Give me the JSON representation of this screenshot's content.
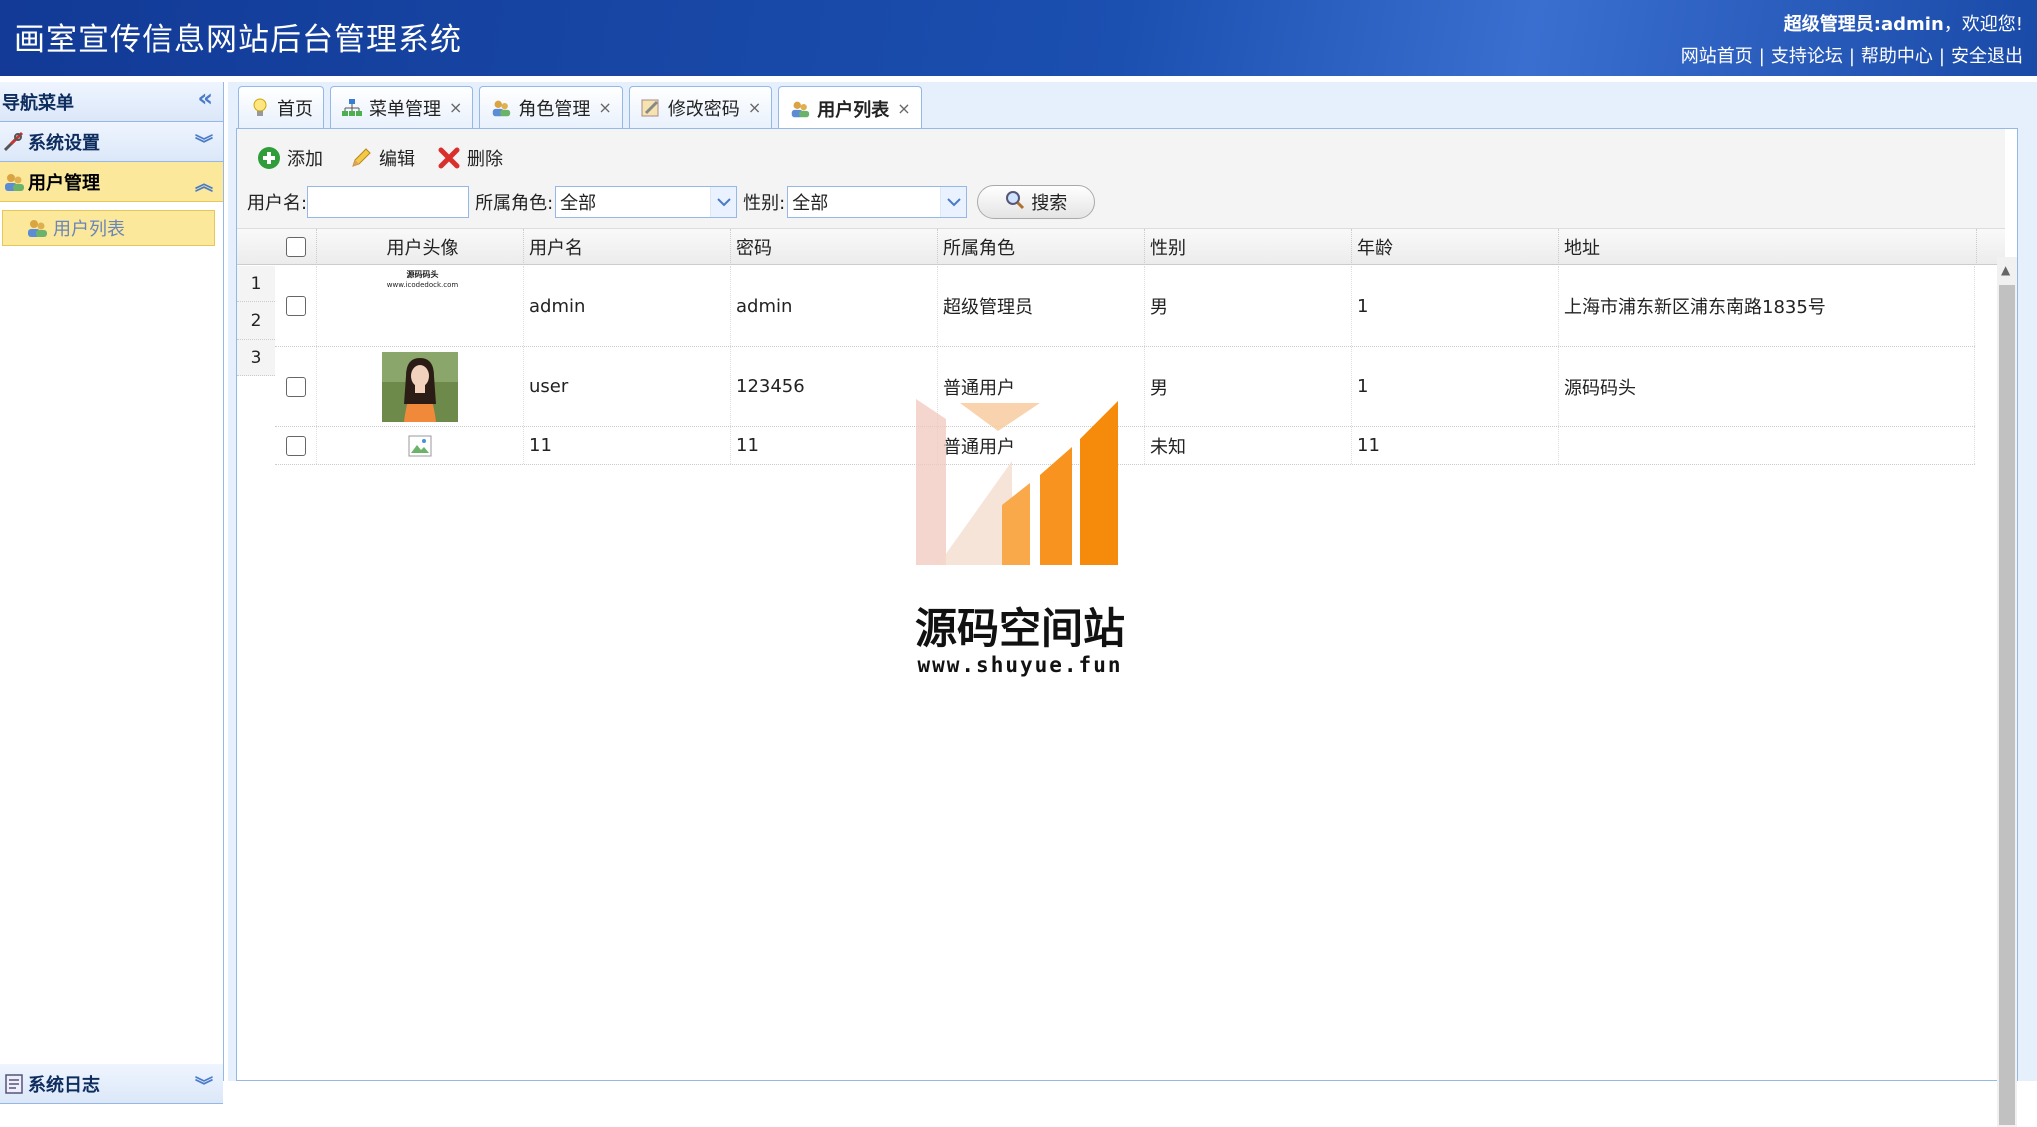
{
  "header": {
    "title": "画室宣传信息网站后台管理系统",
    "welcome_user": "超级管理员:admin",
    "welcome_suffix": "，欢迎您!",
    "links": [
      "网站首页",
      "支持论坛",
      "帮助中心",
      "安全退出"
    ]
  },
  "sidebar": {
    "title": "导航菜单",
    "collapse_glyph": "«",
    "groups": [
      {
        "label": "系统设置",
        "chevron": "︾"
      },
      {
        "label": "用户管理",
        "chevron": "︽",
        "items": [
          {
            "label": "用户列表"
          }
        ]
      },
      {
        "label": "系统日志",
        "chevron": "︾"
      }
    ]
  },
  "tabs": [
    {
      "label": "首页",
      "closable": false
    },
    {
      "label": "菜单管理",
      "closable": true
    },
    {
      "label": "角色管理",
      "closable": true
    },
    {
      "label": "修改密码",
      "closable": true
    },
    {
      "label": "用户列表",
      "closable": true,
      "active": true
    }
  ],
  "close_glyph": "×",
  "toolbar": {
    "add": "添加",
    "edit": "编辑",
    "delete": "删除"
  },
  "search": {
    "username_label": "用户名:",
    "username_value": "",
    "role_label": "所属角色:",
    "role_value": "全部",
    "gender_label": "性别:",
    "gender_value": "全部",
    "search_button": "搜索"
  },
  "grid": {
    "columns": [
      "用户头像",
      "用户名",
      "密码",
      "所属角色",
      "性别",
      "年龄",
      "地址"
    ],
    "row_numbers": [
      "1",
      "2",
      "3"
    ],
    "rows": [
      {
        "avatar_text1": "源码码头",
        "avatar_text2": "www.icodedock.com",
        "username": "admin",
        "password": "admin",
        "role": "超级管理员",
        "gender": "男",
        "age": "1",
        "address": "上海市浦东新区浦东南路1835号"
      },
      {
        "username": "user",
        "password": "123456",
        "role": "普通用户",
        "gender": "男",
        "age": "1",
        "address": "源码码头"
      },
      {
        "username": "11",
        "password": "11",
        "role": "普通用户",
        "gender": "未知",
        "age": "11",
        "address": ""
      }
    ]
  },
  "watermark": {
    "name": "源码空间站",
    "url": "www.shuyue.fun"
  },
  "colors": {
    "header_bg": "#1b4fb0",
    "active_highlight": "#fbe89a",
    "border": "#95b8e7",
    "watermark_orange": "#f7941d"
  }
}
